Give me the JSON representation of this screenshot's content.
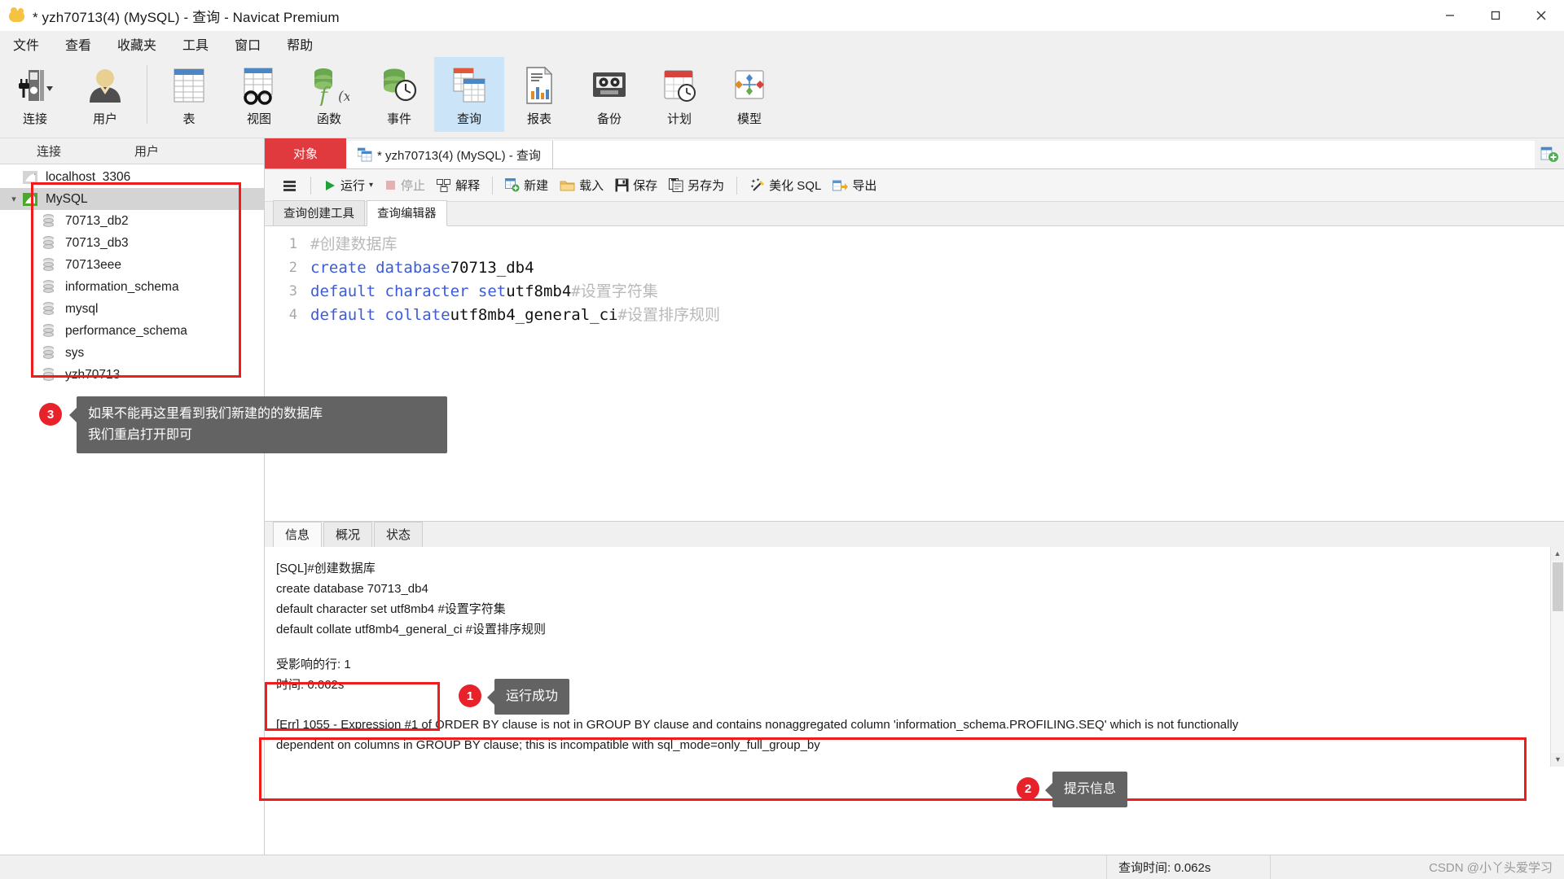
{
  "window": {
    "title": "* yzh70713(4) (MySQL) - 查询 - Navicat Premium",
    "minimize": "—",
    "maximize": "❐",
    "close": "✕"
  },
  "menubar": {
    "items": [
      {
        "label": "文件"
      },
      {
        "label": "查看"
      },
      {
        "label": "收藏夹"
      },
      {
        "label": "工具"
      },
      {
        "label": "窗口"
      },
      {
        "label": "帮助"
      }
    ]
  },
  "toolbar": {
    "items": [
      {
        "label": "连接",
        "icon": "connection-icon",
        "active": false,
        "dropdown": true
      },
      {
        "label": "用户",
        "icon": "user-icon",
        "active": false
      },
      {
        "label": "表",
        "icon": "table-icon",
        "active": false
      },
      {
        "label": "视图",
        "icon": "view-icon",
        "active": false
      },
      {
        "label": "函数",
        "icon": "function-icon",
        "active": false
      },
      {
        "label": "事件",
        "icon": "event-icon",
        "active": false
      },
      {
        "label": "查询",
        "icon": "query-icon",
        "active": true
      },
      {
        "label": "报表",
        "icon": "report-icon",
        "active": false
      },
      {
        "label": "备份",
        "icon": "backup-icon",
        "active": false
      },
      {
        "label": "计划",
        "icon": "schedule-icon",
        "active": false
      },
      {
        "label": "模型",
        "icon": "model-icon",
        "active": false
      }
    ]
  },
  "sidebar": {
    "header": {
      "col1": "连接",
      "col2": "用户"
    },
    "tree": [
      {
        "label": "localhost_3306",
        "icon": "connection-node-icon",
        "indent": 1,
        "expanded": null,
        "selected": false
      },
      {
        "label": "MySQL",
        "icon": "connection-node-icon-active",
        "indent": 1,
        "expanded": true,
        "selected": true
      },
      {
        "label": "70713_db2",
        "icon": "database-icon",
        "indent": 2,
        "expanded": null,
        "selected": false
      },
      {
        "label": "70713_db3",
        "icon": "database-icon",
        "indent": 2,
        "expanded": null,
        "selected": false
      },
      {
        "label": "70713eee",
        "icon": "database-icon",
        "indent": 2,
        "expanded": null,
        "selected": false
      },
      {
        "label": "information_schema",
        "icon": "database-icon",
        "indent": 2,
        "expanded": null,
        "selected": false
      },
      {
        "label": "mysql",
        "icon": "database-icon",
        "indent": 2,
        "expanded": null,
        "selected": false
      },
      {
        "label": "performance_schema",
        "icon": "database-icon",
        "indent": 2,
        "expanded": null,
        "selected": false
      },
      {
        "label": "sys",
        "icon": "database-icon",
        "indent": 2,
        "expanded": null,
        "selected": false
      },
      {
        "label": "yzh70713",
        "icon": "database-icon",
        "indent": 2,
        "expanded": null,
        "selected": false
      }
    ]
  },
  "tabs": {
    "object_tab": "对象",
    "query_tab": "* yzh70713(4) (MySQL) - 查询",
    "add_tab": "+"
  },
  "query_toolbar": {
    "menu_icon": "hamburger-icon",
    "buttons": [
      {
        "label": "运行",
        "icon": "play-icon",
        "disabled": false,
        "dropdown": true
      },
      {
        "label": "停止",
        "icon": "stop-icon",
        "disabled": true
      },
      {
        "label": "解释",
        "icon": "explain-icon",
        "disabled": false
      },
      {
        "label": "新建",
        "icon": "new-icon",
        "disabled": false
      },
      {
        "label": "载入",
        "icon": "load-folder-icon",
        "disabled": false
      },
      {
        "label": "保存",
        "icon": "save-icon",
        "disabled": false
      },
      {
        "label": "另存为",
        "icon": "save-as-icon",
        "disabled": false
      },
      {
        "label": "美化 SQL",
        "icon": "beautify-icon",
        "disabled": false
      },
      {
        "label": "导出",
        "icon": "export-icon",
        "disabled": false
      }
    ]
  },
  "editor": {
    "tabs": [
      {
        "label": "查询创建工具",
        "active": false
      },
      {
        "label": "查询编辑器",
        "active": true
      }
    ],
    "lines": [
      {
        "no": "1",
        "tokens": [
          {
            "t": "#创建数据库",
            "c": "cmt"
          }
        ]
      },
      {
        "no": "2",
        "tokens": [
          {
            "t": "create database ",
            "c": "kw"
          },
          {
            "t": "70713_db4",
            "c": "idn"
          }
        ]
      },
      {
        "no": "3",
        "tokens": [
          {
            "t": "default character set ",
            "c": "kw"
          },
          {
            "t": "utf8mb4 ",
            "c": "idn"
          },
          {
            "t": "#设置字符集",
            "c": "cmt"
          }
        ]
      },
      {
        "no": "4",
        "tokens": [
          {
            "t": "default collate ",
            "c": "kw"
          },
          {
            "t": "utf8mb4_general_ci ",
            "c": "idn"
          },
          {
            "t": "#设置排序规则",
            "c": "cmt"
          }
        ]
      }
    ]
  },
  "results": {
    "tabs": [
      {
        "label": "信息",
        "active": true
      },
      {
        "label": "概况",
        "active": false
      },
      {
        "label": "状态",
        "active": false
      }
    ],
    "log_lines": [
      "[SQL]#创建数据库",
      "create database 70713_db4",
      "default character set utf8mb4 #设置字符集",
      "default collate utf8mb4_general_ci #设置排序规则"
    ],
    "affected_rows": "受影响的行: 1",
    "time": "时间: 0.062s",
    "error_line1": "[Err] 1055 - Expression #1 of ORDER BY clause is not in GROUP BY clause and contains nonaggregated column 'information_schema.PROFILING.SEQ' which is not functionally",
    "error_line2": "dependent on columns in GROUP BY clause; this is incompatible with sql_mode=only_full_group_by"
  },
  "statusbar": {
    "query_time_label": "查询时间: 0.062s",
    "watermark": "CSDN @小丫头爱学习"
  },
  "annotations": [
    {
      "id": "1",
      "number": "1",
      "text": "运行成功"
    },
    {
      "id": "2",
      "number": "2",
      "text": "提示信息"
    },
    {
      "id": "3",
      "number": "3",
      "text": "如果不能再这里看到我们新建的的数据库\n我们重启打开即可"
    }
  ],
  "colors": {
    "accent_red": "#e03a3f",
    "annotation_red": "#f01b1b",
    "bubble_red": "#e8222a",
    "callout_gray": "#636363",
    "tab_active_blue": "#cce4f7",
    "keyword_blue": "#3b5bdb"
  }
}
